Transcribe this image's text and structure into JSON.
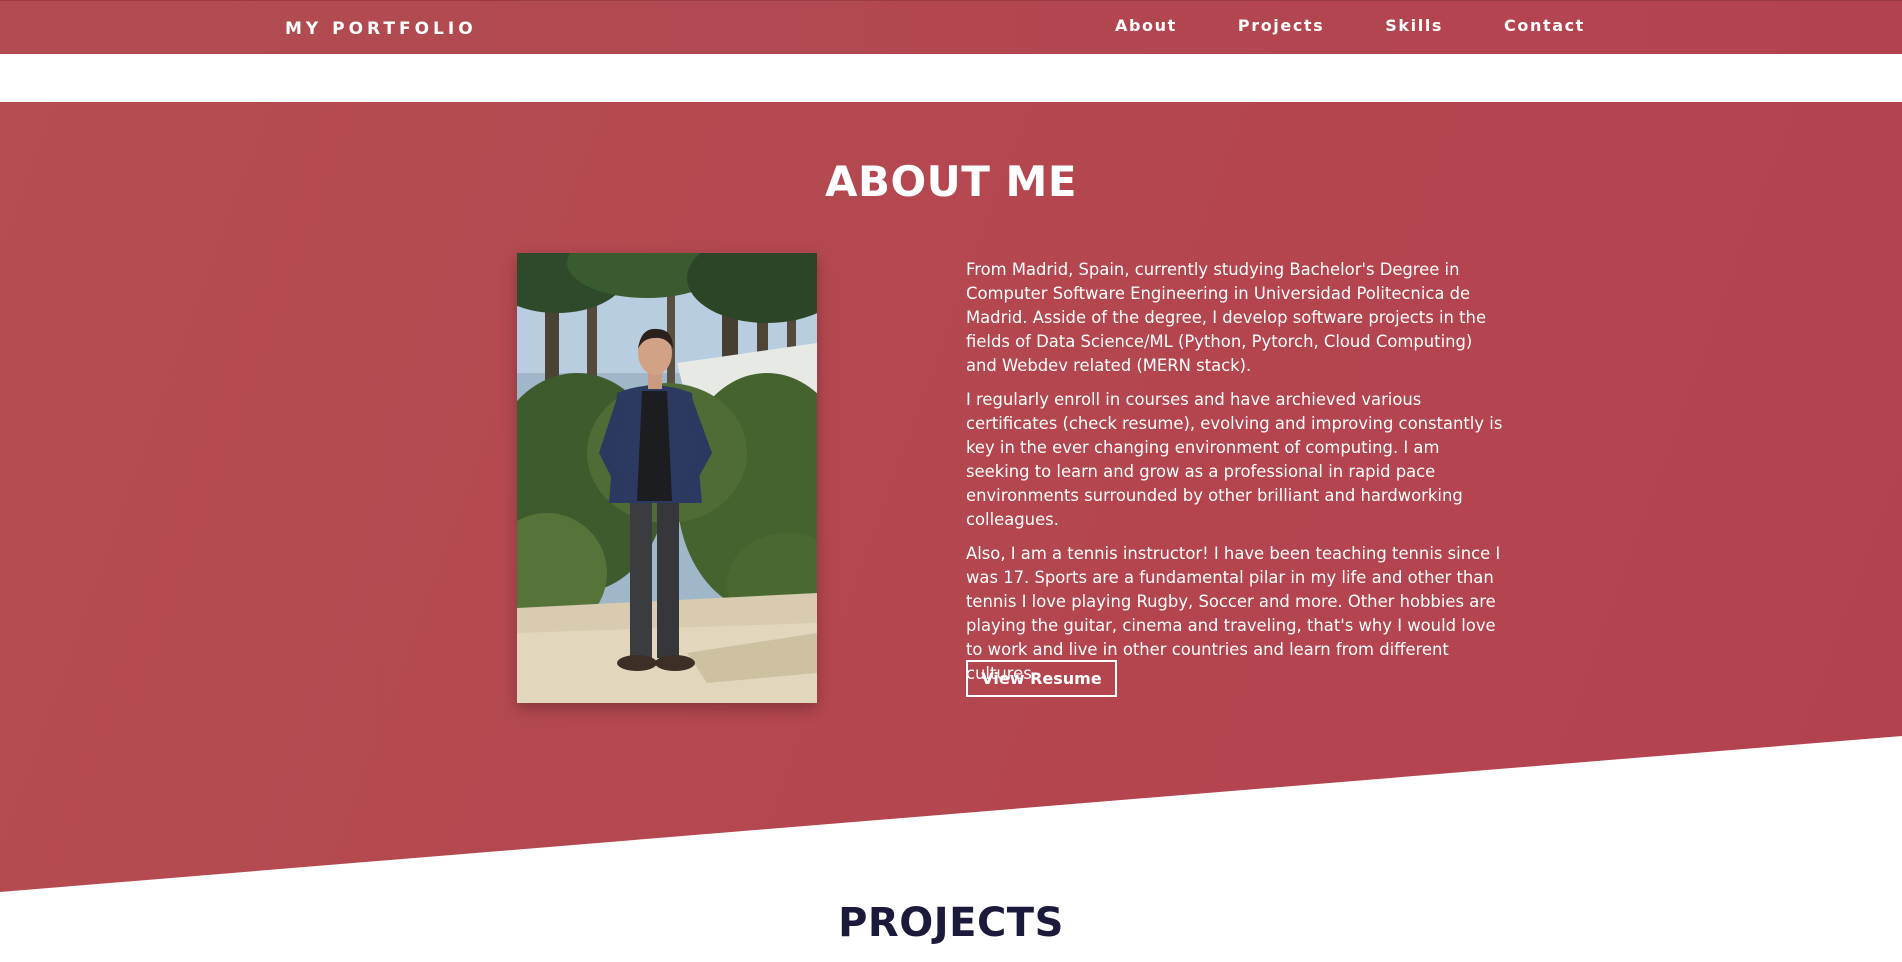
{
  "nav": {
    "brand": "MY PORTFOLIO",
    "links": [
      "About",
      "Projects",
      "Skills",
      "Contact"
    ]
  },
  "about": {
    "title": "ABOUT ME",
    "paragraphs": [
      "From Madrid, Spain, currently studying Bachelor's Degree in Computer Software Engineering in Universidad Politecnica de Madrid. Asside of the degree, I develop software projects in the fields of Data Science/ML (Python, Pytorch, Cloud Computing) and Webdev related (MERN stack).",
      "I regularly enroll in courses and have archieved various certificates (check resume), evolving and improving constantly is key in the ever changing environment of computing. I am seeking to learn and grow as a professional in rapid pace environments surrounded by other brilliant and hardworking colleagues.",
      "Also, I am a tennis instructor! I have been teaching tennis since I was 17. Sports are a fundamental pilar in my life and other than tennis I love playing Rugby, Soccer and more. Other hobbies are playing the guitar, cinema and traveling, that's why I would love to work and live in other countries and learn from different cultures."
    ],
    "resume_button": "View Resume"
  },
  "projects": {
    "title": "PROJECTS"
  },
  "colors": {
    "accent": "#b3424f",
    "heading_dark": "#1c1a3a"
  }
}
